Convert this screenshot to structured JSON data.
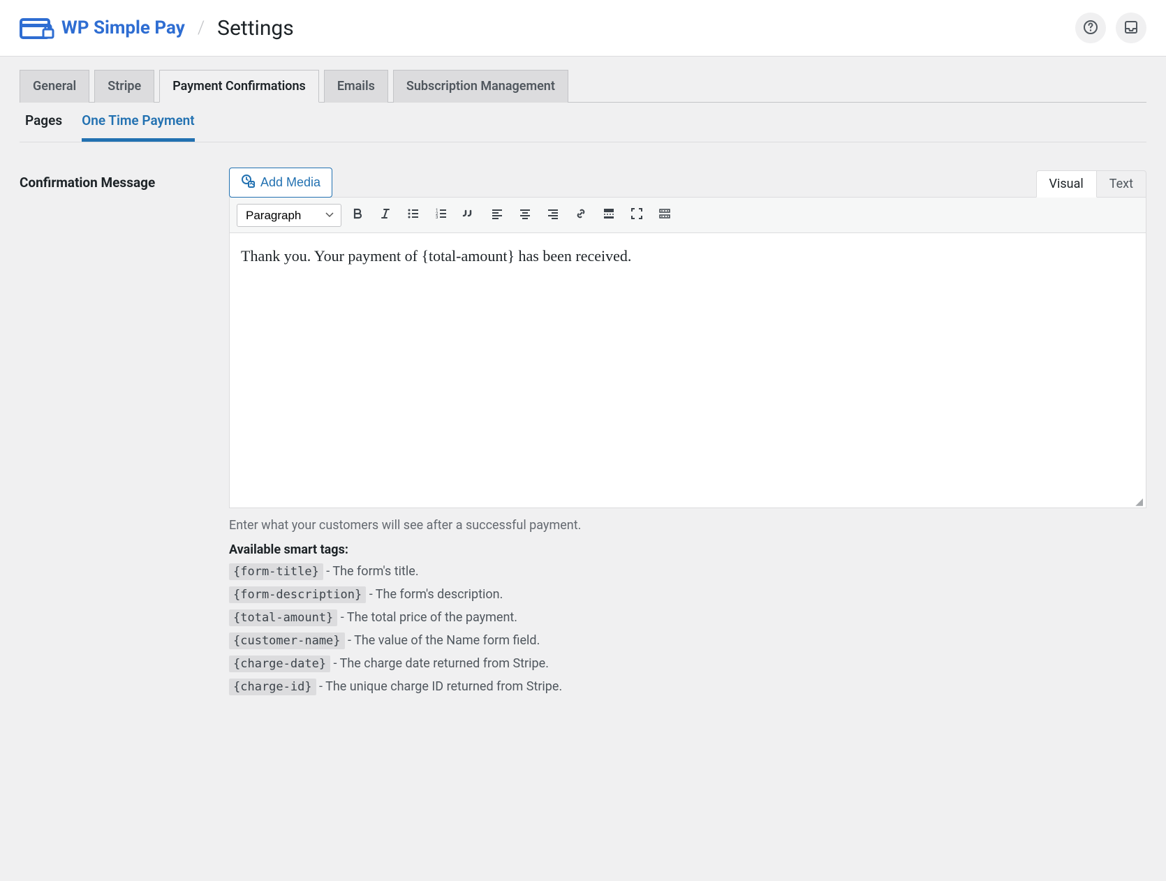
{
  "header": {
    "brand": "WP Simple Pay",
    "separator": "/",
    "page_title": "Settings"
  },
  "tabs": [
    {
      "id": "general",
      "label": "General",
      "active": false
    },
    {
      "id": "stripe",
      "label": "Stripe",
      "active": false
    },
    {
      "id": "payment-confirmations",
      "label": "Payment Confirmations",
      "active": true
    },
    {
      "id": "emails",
      "label": "Emails",
      "active": false
    },
    {
      "id": "subscription-management",
      "label": "Subscription Management",
      "active": false
    }
  ],
  "subtabs": [
    {
      "id": "pages",
      "label": "Pages",
      "active": false
    },
    {
      "id": "one-time-payment",
      "label": "One Time Payment",
      "active": true
    }
  ],
  "form": {
    "label": "Confirmation Message",
    "add_media": "Add Media",
    "editor_tabs": {
      "visual": "Visual",
      "text": "Text"
    },
    "format_select": "Paragraph",
    "content": "Thank you. Your payment of {total-amount} has been received.",
    "help": "Enter what your customers will see after a successful payment.",
    "smart_tags_label": "Available smart tags:",
    "smart_tags": [
      {
        "tag": "{form-title}",
        "desc": " - The form's title."
      },
      {
        "tag": "{form-description}",
        "desc": " - The form's description."
      },
      {
        "tag": "{total-amount}",
        "desc": " - The total price of the payment."
      },
      {
        "tag": "{customer-name}",
        "desc": " - The value of the Name form field."
      },
      {
        "tag": "{charge-date}",
        "desc": " - The charge date returned from Stripe."
      },
      {
        "tag": "{charge-id}",
        "desc": " - The unique charge ID returned from Stripe."
      }
    ]
  }
}
